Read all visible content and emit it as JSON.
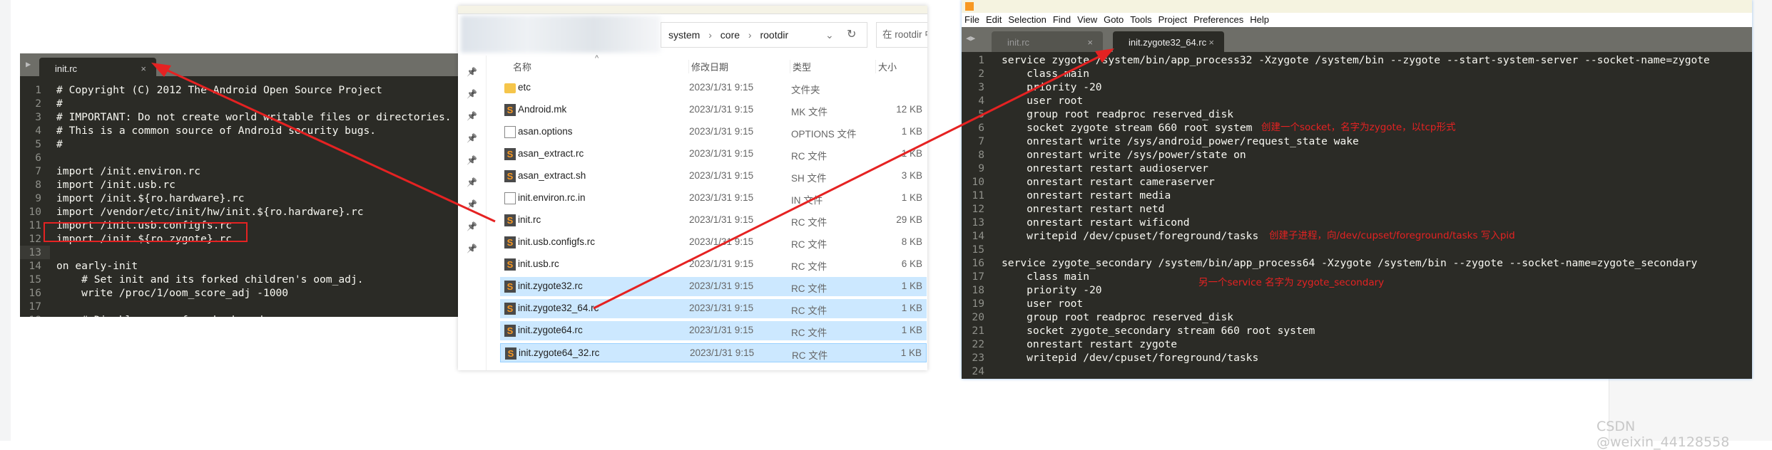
{
  "left_editor": {
    "tab": "init.rc",
    "close": "×",
    "lines": [
      "# Copyright (C) 2012 The Android Open Source Project",
      "#",
      "# IMPORTANT: Do not create world writable files or directories.",
      "# This is a common source of Android security bugs.",
      "#",
      "",
      "import /init.environ.rc",
      "import /init.usb.rc",
      "import /init.${ro.hardware}.rc",
      "import /vendor/etc/init/hw/init.${ro.hardware}.rc",
      "import /init.usb.configfs.rc",
      "import /init.${ro.zygote}.rc",
      "",
      "on early-init",
      "    # Set init and its forked children's oom_adj.",
      "    write /proc/1/oom_score_adj -1000",
      "",
      "    # Disable sysrq from keyboard"
    ],
    "highlighted_line": 12
  },
  "explorer": {
    "path": [
      "system",
      "core",
      "rootdir"
    ],
    "search_placeholder": "在 rootdir 中搜索",
    "columns": [
      "名称",
      "修改日期",
      "类型",
      "大小"
    ],
    "rows": [
      {
        "name": "etc",
        "date": "2023/1/31 9:15",
        "type": "文件夹",
        "size": "",
        "icon": "folder",
        "selected": false
      },
      {
        "name": "Android.mk",
        "date": "2023/1/31 9:15",
        "type": "MK 文件",
        "size": "12 KB",
        "icon": "sublime",
        "selected": false
      },
      {
        "name": "asan.options",
        "date": "2023/1/31 9:15",
        "type": "OPTIONS 文件",
        "size": "1 KB",
        "icon": "blank",
        "selected": false
      },
      {
        "name": "asan_extract.rc",
        "date": "2023/1/31 9:15",
        "type": "RC 文件",
        "size": "1 KB",
        "icon": "sublime",
        "selected": false
      },
      {
        "name": "asan_extract.sh",
        "date": "2023/1/31 9:15",
        "type": "SH 文件",
        "size": "3 KB",
        "icon": "sublime",
        "selected": false
      },
      {
        "name": "init.environ.rc.in",
        "date": "2023/1/31 9:15",
        "type": "IN 文件",
        "size": "1 KB",
        "icon": "blank",
        "selected": false
      },
      {
        "name": "init.rc",
        "date": "2023/1/31 9:15",
        "type": "RC 文件",
        "size": "29 KB",
        "icon": "sublime",
        "selected": false
      },
      {
        "name": "init.usb.configfs.rc",
        "date": "2023/1/31 9:15",
        "type": "RC 文件",
        "size": "8 KB",
        "icon": "sublime",
        "selected": false
      },
      {
        "name": "init.usb.rc",
        "date": "2023/1/31 9:15",
        "type": "RC 文件",
        "size": "6 KB",
        "icon": "sublime",
        "selected": false
      },
      {
        "name": "init.zygote32.rc",
        "date": "2023/1/31 9:15",
        "type": "RC 文件",
        "size": "1 KB",
        "icon": "sublime",
        "selected": true
      },
      {
        "name": "init.zygote32_64.rc",
        "date": "2023/1/31 9:15",
        "type": "RC 文件",
        "size": "1 KB",
        "icon": "sublime",
        "selected": true
      },
      {
        "name": "init.zygote64.rc",
        "date": "2023/1/31 9:15",
        "type": "RC 文件",
        "size": "1 KB",
        "icon": "sublime",
        "selected": true
      },
      {
        "name": "init.zygote64_32.rc",
        "date": "2023/1/31 9:15",
        "type": "RC 文件",
        "size": "1 KB",
        "icon": "sublime",
        "selected": true
      }
    ]
  },
  "right_editor": {
    "menu": [
      "File",
      "Edit",
      "Selection",
      "Find",
      "View",
      "Goto",
      "Tools",
      "Project",
      "Preferences",
      "Help"
    ],
    "tabs": [
      {
        "label": "init.rc",
        "active": false
      },
      {
        "label": "init.zygote32_64.rc",
        "active": true
      }
    ],
    "close": "×",
    "lines": [
      "service zygote /system/bin/app_process32 -Xzygote /system/bin --zygote --start-system-server --socket-name=zygote",
      "    class main",
      "    priority -20",
      "    user root",
      "    group root readproc reserved_disk",
      "    socket zygote stream 660 root system",
      "    onrestart write /sys/android_power/request_state wake",
      "    onrestart write /sys/power/state on",
      "    onrestart restart audioserver",
      "    onrestart restart cameraserver",
      "    onrestart restart media",
      "    onrestart restart netd",
      "    onrestart restart wificond",
      "    writepid /dev/cpuset/foreground/tasks",
      "",
      "service zygote_secondary /system/bin/app_process64 -Xzygote /system/bin --zygote --socket-name=zygote_secondary",
      "    class main",
      "    priority -20",
      "    user root",
      "    group root readproc reserved_disk",
      "    socket zygote_secondary stream 660 root system",
      "    onrestart restart zygote",
      "    writepid /dev/cpuset/foreground/tasks",
      ""
    ],
    "annotations": [
      "创建一个socket，名字为zygote，以tcp形式",
      "创建子进程，向/dev/cupset/foreground/tasks 写入pid",
      "另一个service 名字为 zygote_secondary"
    ]
  },
  "annotation_color": "#e52222",
  "watermark": "CSDN @weixin_44128558"
}
